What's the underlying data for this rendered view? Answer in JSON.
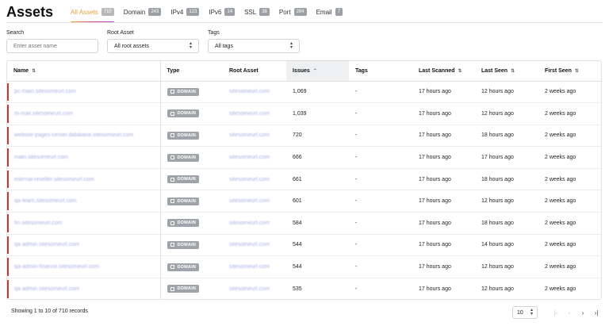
{
  "page": {
    "title": "Assets"
  },
  "tabs": [
    {
      "label": "All Assets",
      "count": "710",
      "active": true
    },
    {
      "label": "Domain",
      "count": "243"
    },
    {
      "label": "IPv4",
      "count": "123"
    },
    {
      "label": "IPv6",
      "count": "14"
    },
    {
      "label": "SSL",
      "count": "38"
    },
    {
      "label": "Port",
      "count": "284"
    },
    {
      "label": "Email",
      "count": "7"
    }
  ],
  "filters": {
    "search": {
      "label": "Search",
      "placeholder": "Enter asset name"
    },
    "root_asset": {
      "label": "Root Asset",
      "value": "All root assets"
    },
    "tags": {
      "label": "Tags",
      "value": "All tags"
    }
  },
  "table": {
    "columns": [
      "Name",
      "Type",
      "Root Asset",
      "Issues",
      "Tags",
      "Last Scanned",
      "Last Seen",
      "First Seen"
    ],
    "rows": [
      {
        "name": "pc-main.sitesomeurl.com",
        "type": "DOMAIN",
        "root": "sitesomeurl.com",
        "issues": "1,069",
        "tags": "-",
        "last_scanned": "17 hours ago",
        "last_seen": "12 hours ago",
        "first_seen": "2 weeks ago"
      },
      {
        "name": "m-mail.sitesomeurl.com",
        "type": "DOMAIN",
        "root": "sitesomeurl.com",
        "issues": "1,039",
        "tags": "-",
        "last_scanned": "17 hours ago",
        "last_seen": "12 hours ago",
        "first_seen": "2 weeks ago"
      },
      {
        "name": "website-pages-center.database.sitesomeurl.com",
        "type": "DOMAIN",
        "root": "sitesomeurl.com",
        "issues": "720",
        "tags": "-",
        "last_scanned": "17 hours ago",
        "last_seen": "18 hours ago",
        "first_seen": "2 weeks ago"
      },
      {
        "name": "main.sitesomeurl.com",
        "type": "DOMAIN",
        "root": "sitesomeurl.com",
        "issues": "666",
        "tags": "-",
        "last_scanned": "17 hours ago",
        "last_seen": "17 hours ago",
        "first_seen": "2 weeks ago"
      },
      {
        "name": "internal-reseller.sitesomeurl.com",
        "type": "DOMAIN",
        "root": "sitesomeurl.com",
        "issues": "661",
        "tags": "-",
        "last_scanned": "17 hours ago",
        "last_seen": "18 hours ago",
        "first_seen": "2 weeks ago"
      },
      {
        "name": "qa-team.sitesomeurl.com",
        "type": "DOMAIN",
        "root": "sitesomeurl.com",
        "issues": "601",
        "tags": "-",
        "last_scanned": "17 hours ago",
        "last_seen": "12 hours ago",
        "first_seen": "2 weeks ago"
      },
      {
        "name": "fin.sitesomeurl.com",
        "type": "DOMAIN",
        "root": "sitesomeurl.com",
        "issues": "584",
        "tags": "-",
        "last_scanned": "17 hours ago",
        "last_seen": "18 hours ago",
        "first_seen": "2 weeks ago"
      },
      {
        "name": "qa-admin.sitesomeurl.com",
        "type": "DOMAIN",
        "root": "sitesomeurl.com",
        "issues": "544",
        "tags": "-",
        "last_scanned": "17 hours ago",
        "last_seen": "14 hours ago",
        "first_seen": "2 weeks ago"
      },
      {
        "name": "qa-admin-finance.sitesomeurl.com",
        "type": "DOMAIN",
        "root": "sitesomeurl.com",
        "issues": "544",
        "tags": "-",
        "last_scanned": "17 hours ago",
        "last_seen": "12 hours ago",
        "first_seen": "2 weeks ago"
      },
      {
        "name": "qa-admin.sitesomeurl.com",
        "type": "DOMAIN",
        "root": "sitesomeurl.com",
        "issues": "535",
        "tags": "-",
        "last_scanned": "17 hours ago",
        "last_seen": "12 hours ago",
        "first_seen": "2 weeks ago"
      }
    ]
  },
  "footer": {
    "records": "Showing 1 to 10 of 710 records"
  },
  "pagination": {
    "page_size": "10"
  },
  "colors": {
    "accent": "#e8a13a",
    "row_marker": "#c33a3a",
    "link": "#aab2e6"
  }
}
